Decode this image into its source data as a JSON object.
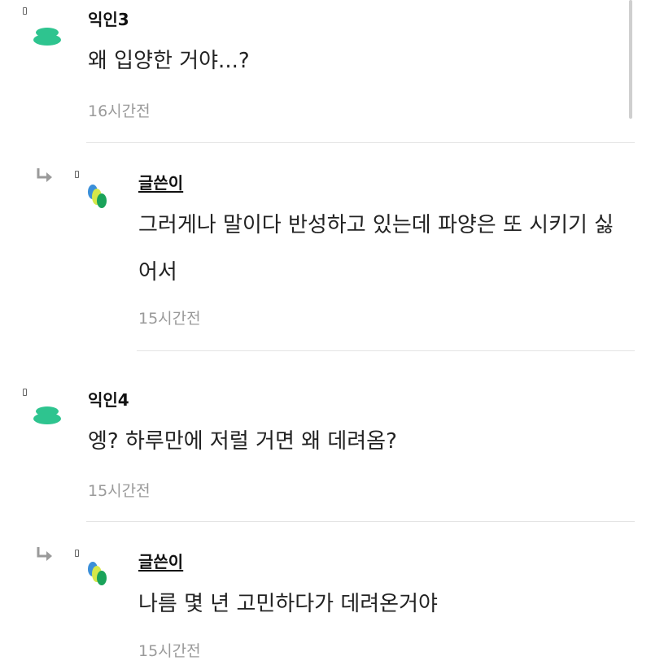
{
  "comments": [
    {
      "author": "익인3",
      "text": "왜 입양한 거야...?",
      "time": "16시간전",
      "avatar": "anon-avatar-icon"
    },
    {
      "author": "글쓴이",
      "text": "그러게나 말이다 반성하고 있는데 파양은 또 시키기 싫어서",
      "time": "15시간전",
      "avatar": "writer-avatar-icon",
      "reply": true
    },
    {
      "author": "익인4",
      "text": "엥? 하루만에 저럴 거면 왜 데려옴?",
      "time": "15시간전",
      "avatar": "anon-avatar-icon"
    },
    {
      "author": "글쓴이",
      "text": "나름 몇 년 고민하다가 데려온거야",
      "time": "15시간전",
      "avatar": "writer-avatar-icon",
      "reply": true
    }
  ],
  "colors": {
    "anon_avatar": "#2ec48f",
    "writer_avatar_blue": "#3b8fd9",
    "writer_avatar_yellow": "#d6e84a",
    "writer_avatar_green": "#1aa35a",
    "timestamp": "#9a9a9a",
    "divider": "#e4e4e4"
  }
}
